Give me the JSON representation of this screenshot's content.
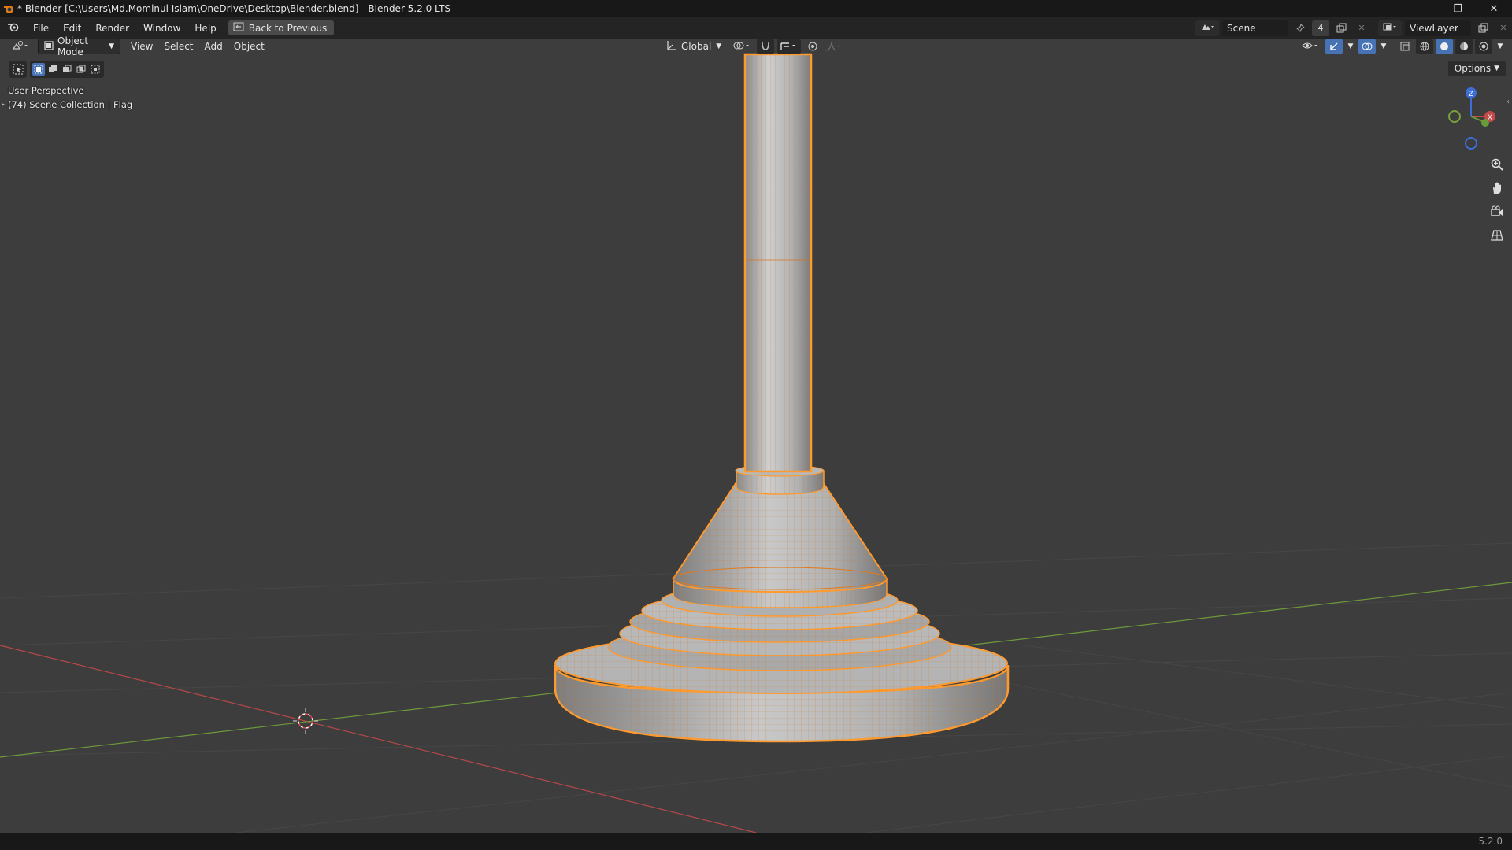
{
  "window": {
    "title": "* Blender [C:\\Users\\Md.Mominul Islam\\OneDrive\\Desktop\\Blender.blend] - Blender 5.2.0 LTS"
  },
  "menubar": {
    "items": [
      "File",
      "Edit",
      "Render",
      "Window",
      "Help"
    ],
    "back_button": "Back to Previous",
    "scene": "Scene",
    "scene_count": "4",
    "view_layer": "ViewLayer"
  },
  "viewport_header": {
    "mode": "Object Mode",
    "menus": [
      "View",
      "Select",
      "Add",
      "Object"
    ],
    "orientation": "Global"
  },
  "viewport": {
    "options_label": "Options",
    "perspective_label": "User Perspective",
    "collection_label": "(74) Scene Collection | Flag",
    "gizmo_axes": {
      "z": "Z",
      "x": "X"
    }
  },
  "colors": {
    "accent": "#4772b3",
    "selection_orange": "#ffa033",
    "x_axis": "#c44a4a",
    "y_axis": "#6a9a3a",
    "z_axis": "#3c6ed6"
  },
  "statusbar": {
    "version": "5.2.0"
  }
}
